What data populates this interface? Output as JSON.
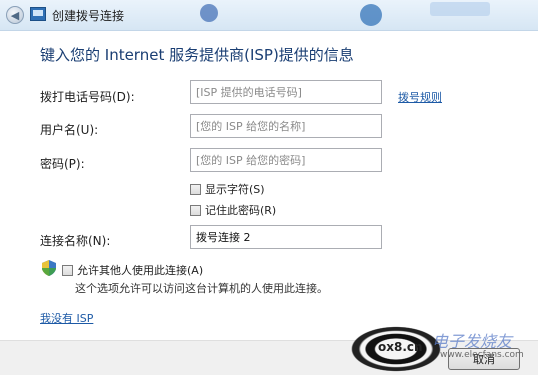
{
  "window": {
    "back_glyph": "◀",
    "title": "创建拨号连接"
  },
  "heading": "键入您的 Internet 服务提供商(ISP)提供的信息",
  "form": {
    "phone": {
      "label": "拨打电话号码(D):",
      "placeholder": "[ISP 提供的电话号码]"
    },
    "dialing_rules_link": "拨号规则",
    "username": {
      "label": "用户名(U):",
      "placeholder": "[您的 ISP 给您的名称]"
    },
    "password": {
      "label": "密码(P):",
      "placeholder": "[您的 ISP 给您的密码]"
    },
    "show_chars": "显示字符(S)",
    "remember_password": "记住此密码(R)",
    "connection_name": {
      "label": "连接名称(N):",
      "value": "拨号连接 2"
    },
    "allow_others": "允许其他人使用此连接(A)",
    "allow_hint": "这个选项允许可以访问这台计算机的人使用此连接。",
    "no_isp_link": "我没有 ISP"
  },
  "footer": {
    "cancel_label": "取消"
  },
  "watermark": {
    "site": "ox8.cn",
    "brand": "电子发烧友",
    "url": "www.elecfans.com"
  },
  "colors": {
    "heading": "#1a3e73",
    "link": "#1d5aa6",
    "titlebar": "#dce9f5"
  }
}
